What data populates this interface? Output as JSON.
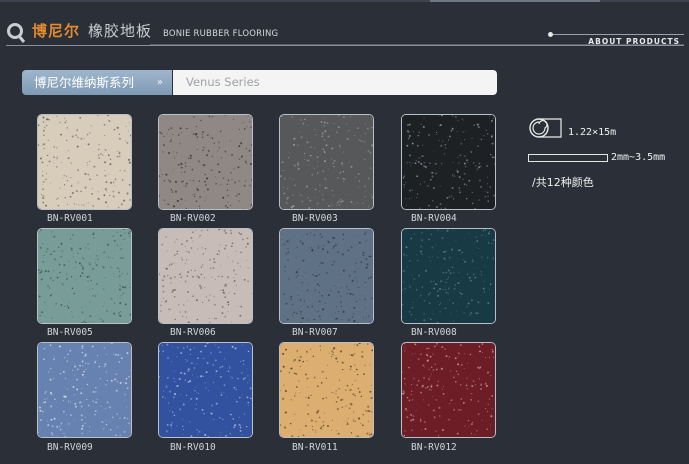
{
  "header": {
    "brand_cn_name": "博尼尔",
    "brand_cn_product": "橡胶地板",
    "brand_en": "BONIE RUBBER FLOORING",
    "about": "ABOUT PRODUCTS"
  },
  "series": {
    "button_label": "博尼尔维纳斯系列",
    "arrow": "»",
    "field_value": "Venus Series"
  },
  "specs": {
    "size": "1.22×15m",
    "thickness": "2mm~3.5mm",
    "colors": "/共12种颜色"
  },
  "products": [
    {
      "code": "BN-RV001",
      "color": "#d8cdbb",
      "speck": "#6c645a"
    },
    {
      "code": "BN-RV002",
      "color": "#8f8884",
      "speck": "#3b3634"
    },
    {
      "code": "BN-RV003",
      "color": "#56585a",
      "speck": "#9c9fa2"
    },
    {
      "code": "BN-RV004",
      "color": "#1e2124",
      "speck": "#8a8f94"
    },
    {
      "code": "BN-RV005",
      "color": "#789c97",
      "speck": "#3b524f"
    },
    {
      "code": "BN-RV006",
      "color": "#c7bcb8",
      "speck": "#6a5f5a"
    },
    {
      "code": "BN-RV007",
      "color": "#5f7185",
      "speck": "#2f3a46"
    },
    {
      "code": "BN-RV008",
      "color": "#173a44",
      "speck": "#5d8088"
    },
    {
      "code": "BN-RV009",
      "color": "#6781b0",
      "speck": "#d2dbea"
    },
    {
      "code": "BN-RV010",
      "color": "#3252a0",
      "speck": "#a8b8de"
    },
    {
      "code": "BN-RV011",
      "color": "#dcae70",
      "speck": "#5a432a"
    },
    {
      "code": "BN-RV012",
      "color": "#6d1d26",
      "speck": "#c49499"
    }
  ]
}
